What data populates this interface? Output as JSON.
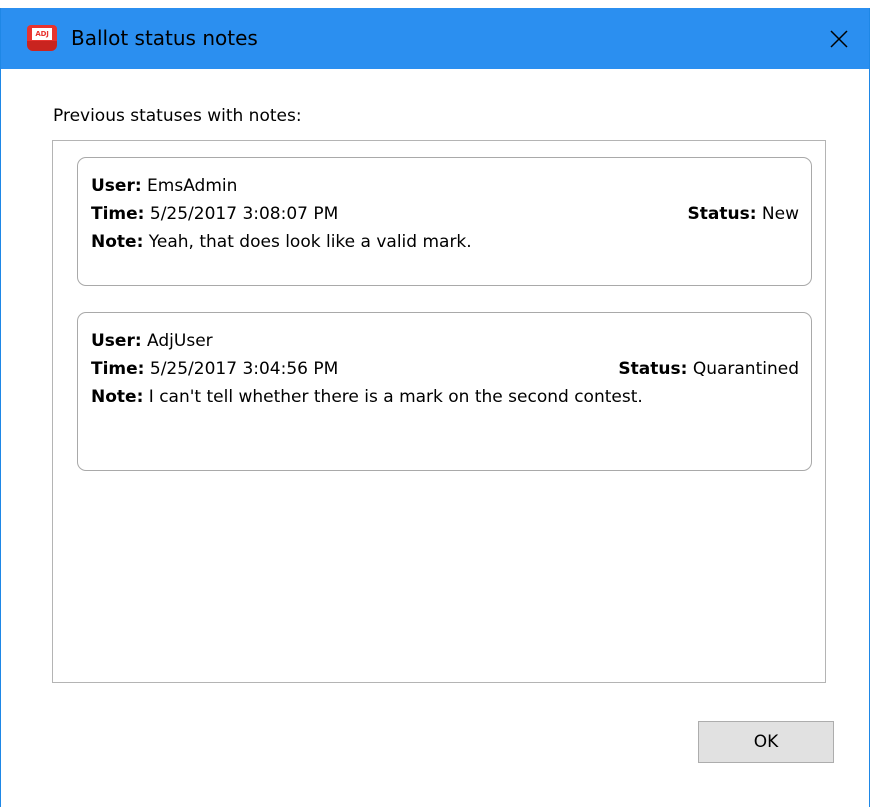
{
  "window": {
    "title": "Ballot status notes",
    "app_icon_text": "ADJ",
    "accent_color": "#2b8ff0"
  },
  "content": {
    "list_label": "Previous statuses with notes:",
    "field_labels": {
      "user": "User:",
      "time": "Time:",
      "status": "Status:",
      "note": "Note:"
    },
    "notes": [
      {
        "user": "EmsAdmin",
        "time": "5/25/2017 3:08:07 PM",
        "status": "New",
        "note": "Yeah, that does look like a valid mark."
      },
      {
        "user": "AdjUser",
        "time": "5/25/2017 3:04:56 PM",
        "status": "Quarantined",
        "note": "I can't tell whether there is a mark on the second contest."
      }
    ]
  },
  "footer": {
    "ok_label": "OK"
  }
}
